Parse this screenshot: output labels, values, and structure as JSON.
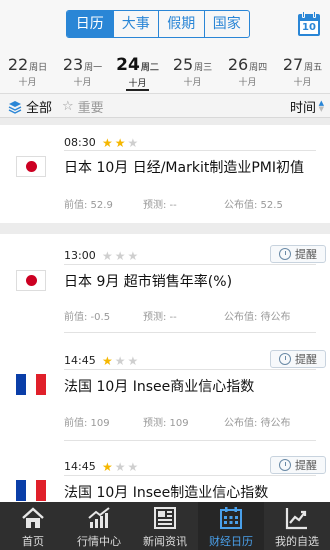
{
  "header": {
    "tabs": [
      {
        "label": "日历",
        "active": true
      },
      {
        "label": "大事",
        "active": false
      },
      {
        "label": "假期",
        "active": false
      },
      {
        "label": "国家",
        "active": false
      }
    ],
    "calendar_day": "10",
    "accent_color": "#2a86d6"
  },
  "dates": [
    {
      "day": "22",
      "weekday": "周日",
      "month": "十月",
      "active": false
    },
    {
      "day": "23",
      "weekday": "周一",
      "month": "十月",
      "active": false
    },
    {
      "day": "24",
      "weekday": "周二",
      "month": "十月",
      "active": true
    },
    {
      "day": "25",
      "weekday": "周三",
      "month": "十月",
      "active": false
    },
    {
      "day": "26",
      "weekday": "周四",
      "month": "十月",
      "active": false
    },
    {
      "day": "27",
      "weekday": "周五",
      "month": "十月",
      "active": false
    }
  ],
  "filter": {
    "all_label": "全部",
    "important_label": "重要",
    "time_label": "时间"
  },
  "events": [
    {
      "time": "08:30",
      "stars": 2,
      "max_stars": 3,
      "country_flag": "japan-flag",
      "title": "日本 10月 日经/Markit制造业PMI初值",
      "previous": "前值: 52.9",
      "forecast": "预测: --",
      "actual": "公布值: 52.5",
      "remind_label": ""
    },
    {
      "time": "13:00",
      "stars": 0,
      "max_stars": 3,
      "country_flag": "japan-flag",
      "title": "日本 9月 超市销售年率(%)",
      "previous": "前值: -0.5",
      "forecast": "预测: --",
      "actual": "公布值: 待公布",
      "remind_label": "提醒"
    },
    {
      "time": "14:45",
      "stars": 1,
      "max_stars": 3,
      "country_flag": "france-flag",
      "title": "法国 10月 Insee商业信心指数",
      "previous": "前值: 109",
      "forecast": "预测: 109",
      "actual": "公布值: 待公布",
      "remind_label": "提醒"
    },
    {
      "time": "14:45",
      "stars": 1,
      "max_stars": 3,
      "country_flag": "france-flag",
      "title": "法国 10月 Insee制造业信心指数",
      "previous": "",
      "forecast": "",
      "actual": "",
      "remind_label": "提醒"
    }
  ],
  "nav": [
    {
      "label": "首页",
      "icon": "home-icon",
      "active": false
    },
    {
      "label": "行情中心",
      "icon": "market-chart-icon",
      "active": false
    },
    {
      "label": "新闻资讯",
      "icon": "news-icon",
      "active": false
    },
    {
      "label": "财经日历",
      "icon": "calendar-icon",
      "active": true
    },
    {
      "label": "我的自选",
      "icon": "watchlist-trend-icon",
      "active": false
    }
  ]
}
